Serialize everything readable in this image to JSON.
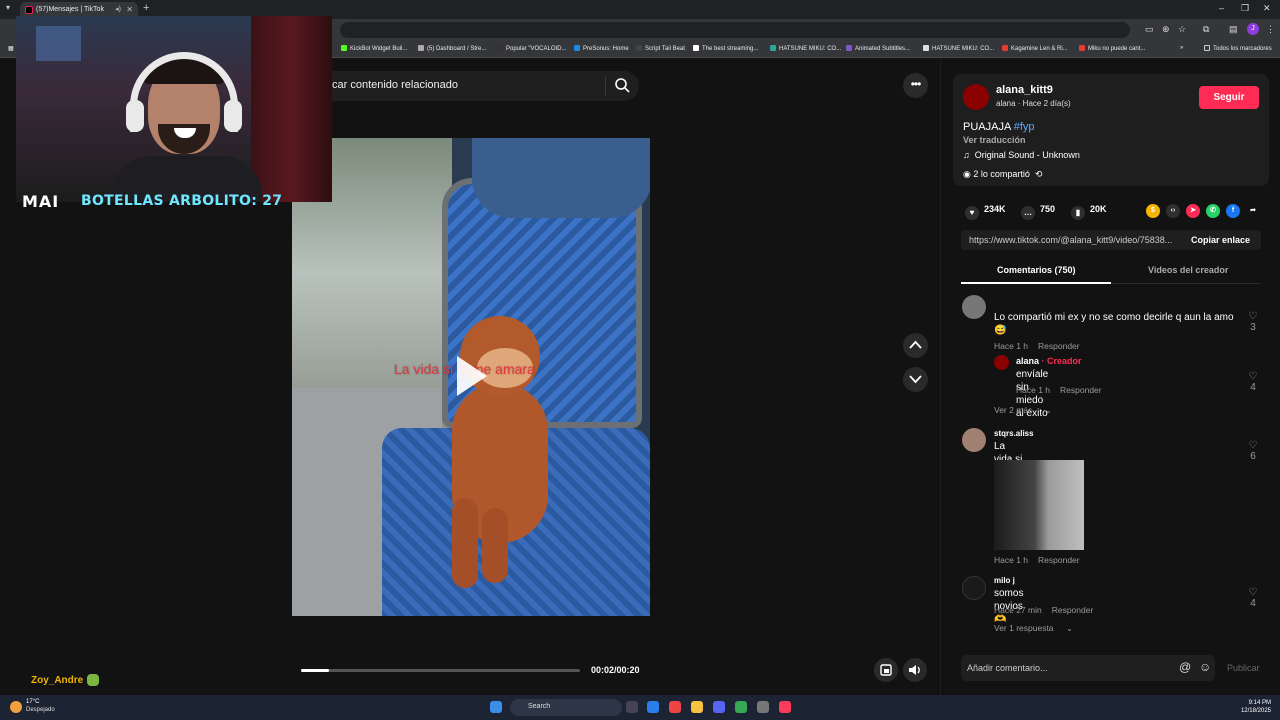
{
  "browser": {
    "tab_title": "(57)Mensajes | TikTok",
    "new_tab": "+",
    "bookmarks": [
      {
        "label": "KickBot Widget Buil...",
        "color": "#53fc18"
      },
      {
        "label": "(5) Dashboard / Stre...",
        "color": "#aaaaaa"
      },
      {
        "label": "Popular \"VOCALOID...",
        "color": "#333333"
      },
      {
        "label": "PreSonus: Home",
        "color": "#1e88e5"
      },
      {
        "label": "Script Tail Beat",
        "color": "#444444"
      },
      {
        "label": "The best streaming...",
        "color": "#ffffff"
      },
      {
        "label": "HATSUNE MIKU: CO...",
        "color": "#26a69a"
      },
      {
        "label": "Animated Subtitles...",
        "color": "#7e57c2"
      },
      {
        "label": "HATSUNE MIKU: CO...",
        "color": "#dddddd"
      },
      {
        "label": "Kagamine Len & Ri...",
        "color": "#e53935"
      },
      {
        "label": "Miku no puede cant...",
        "color": "#e53935"
      }
    ],
    "all_bookmarks": "Todos los marcadores",
    "avatar_letter": "J"
  },
  "stream_overlay": {
    "counter_logo": "MAI",
    "counter_text": "BOTELLAS ARBOLITO: 27",
    "viewer_name": "Zoy_Andre"
  },
  "search": {
    "text": "car contenido relacionado"
  },
  "video": {
    "caption": "La vida si él me amara",
    "progress": 0.1,
    "time": "00:02/00:20"
  },
  "post": {
    "username": "alana_kitt9",
    "subtitle": "alana · Hace 2 día(s)",
    "follow_label": "Seguir",
    "description": "PUAJAJA ",
    "hashtag": "#fyp",
    "translate": "Ver traducción",
    "sound": "Original Sound - Unknown",
    "shared": "2 lo compartió",
    "likes": "234K",
    "comments": "750",
    "saves": "20K",
    "url": "https://www.tiktok.com/@alana_kitt9/video/75838...",
    "copy_label": "Copiar enlace",
    "tab_comments": "Comentarios (750)",
    "tab_videos": "Videos del creador"
  },
  "comments": [
    {
      "text": "Lo compartió mi ex y no se como decirle q aun la amo 😅",
      "time": "Hace 1 h",
      "reply": "Responder",
      "likes": "3",
      "reply_item": {
        "user": "alana",
        "badge": " · Creador",
        "text": "envíale sin miedo al éxito",
        "time": "Hace 1 h",
        "reply": "Responder",
        "likes": "4"
      },
      "more": "Ver 2 más"
    },
    {
      "user": "stqrs.aliss",
      "text": "La vida si él me amara de verdad",
      "time": "Hace 1 h",
      "reply": "Responder",
      "likes": "6"
    },
    {
      "user": "milo j",
      "text": "somos novios🫶",
      "time": "Hace 27 min",
      "reply": "Responder",
      "likes": "4",
      "more": "Ver 1 respuesta"
    }
  ],
  "comment_input": {
    "placeholder": "Añadir comentario...",
    "publish": "Publicar"
  },
  "taskbar": {
    "temp": "17°C",
    "weather": "Despejado",
    "search": "Search",
    "time": "9:14 PM",
    "date": "12/18/2025"
  }
}
